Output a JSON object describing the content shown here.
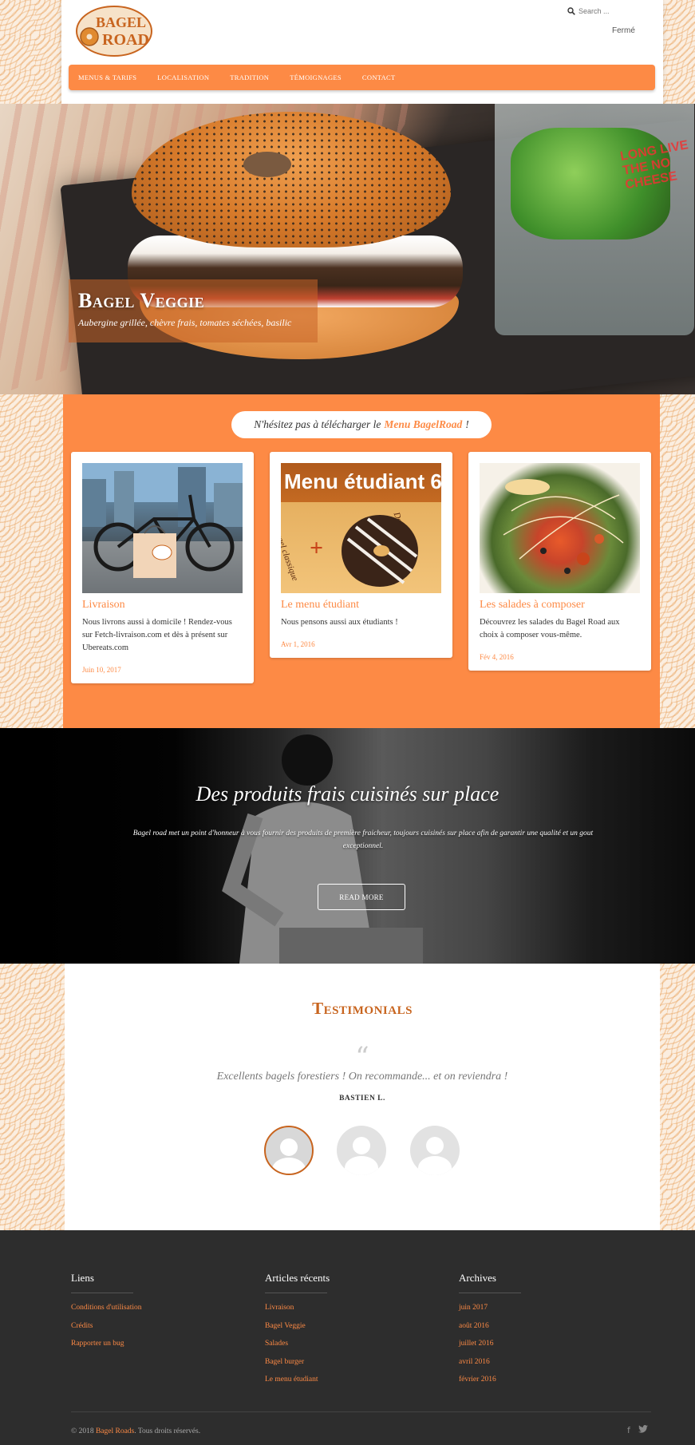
{
  "header": {
    "logo_line1": "BAGEL",
    "logo_line2": "ROAD",
    "search_placeholder": "Search ...",
    "status": "Fermé"
  },
  "nav": {
    "items": [
      "Menus & Tarifs",
      "Localisation",
      "Tradition",
      "Témoignages",
      "Contact"
    ]
  },
  "hero": {
    "title": "Bagel Veggie",
    "subtitle": "Aubergine grillée, chèvre frais, tomates séchées, basilic",
    "glass_label": "LONG LIVE THE NO CHEESE",
    "slide_count": 5,
    "active_slide": 1,
    "colors": {
      "accent": "#fd8a45"
    }
  },
  "download": {
    "prefix": "N'hésitez pas à télécharger le",
    "link": "Menu BagelRoad",
    "suffix": "!"
  },
  "cards": [
    {
      "title": "Livraison",
      "text": "Nous livrons aussi à domicile ! Rendez-vous sur Fetch-livraison.com et dès à présent sur Ubereats.com",
      "date": "Juin 10, 2017"
    },
    {
      "title": "Le menu étudiant",
      "text": "Nous pensons aussi aux étudiants !",
      "date": "Avr 1, 2016",
      "img_text": "Menu étudiant 6",
      "img_side": "Bagel classique",
      "img_side2": "Dessert"
    },
    {
      "title": "Les salades à composer",
      "text": "Découvrez les salades du Bagel Road aux choix à composer vous-même.",
      "date": "Fév 4, 2016"
    }
  ],
  "feature": {
    "title": "Des produits frais cuisinés sur place",
    "text": "Bagel road met un point d'honneur à vous fournir des produits de première fraicheur, toujours cuisinés sur place afin de garantir une qualité et un gout exceptionnel.",
    "button": "READ MORE"
  },
  "testimonials": {
    "title": "Testimonials",
    "quote_mark": "“",
    "quote": "Excellents bagels forestiers ! On recommande... et on reviendra !",
    "author": "BASTIEN L."
  },
  "footer": {
    "cols": [
      {
        "title": "Liens",
        "links": [
          "Conditions d'utilisation",
          "Crédits",
          "Rapporter un bug"
        ]
      },
      {
        "title": "Articles récents",
        "links": [
          "Livraison",
          "Bagel Veggie",
          "Salades",
          "Bagel burger",
          "Le menu étudiant"
        ]
      },
      {
        "title": "Archives",
        "links": [
          "juin 2017",
          "août 2016",
          "juillet 2016",
          "avril 2016",
          "février 2016"
        ]
      }
    ],
    "copy_prefix": "© 2018",
    "copy_brand": "Bagel Roads",
    "copy_suffix": ". Tous droits réservés.",
    "social": [
      "facebook-icon",
      "twitter-icon"
    ]
  }
}
